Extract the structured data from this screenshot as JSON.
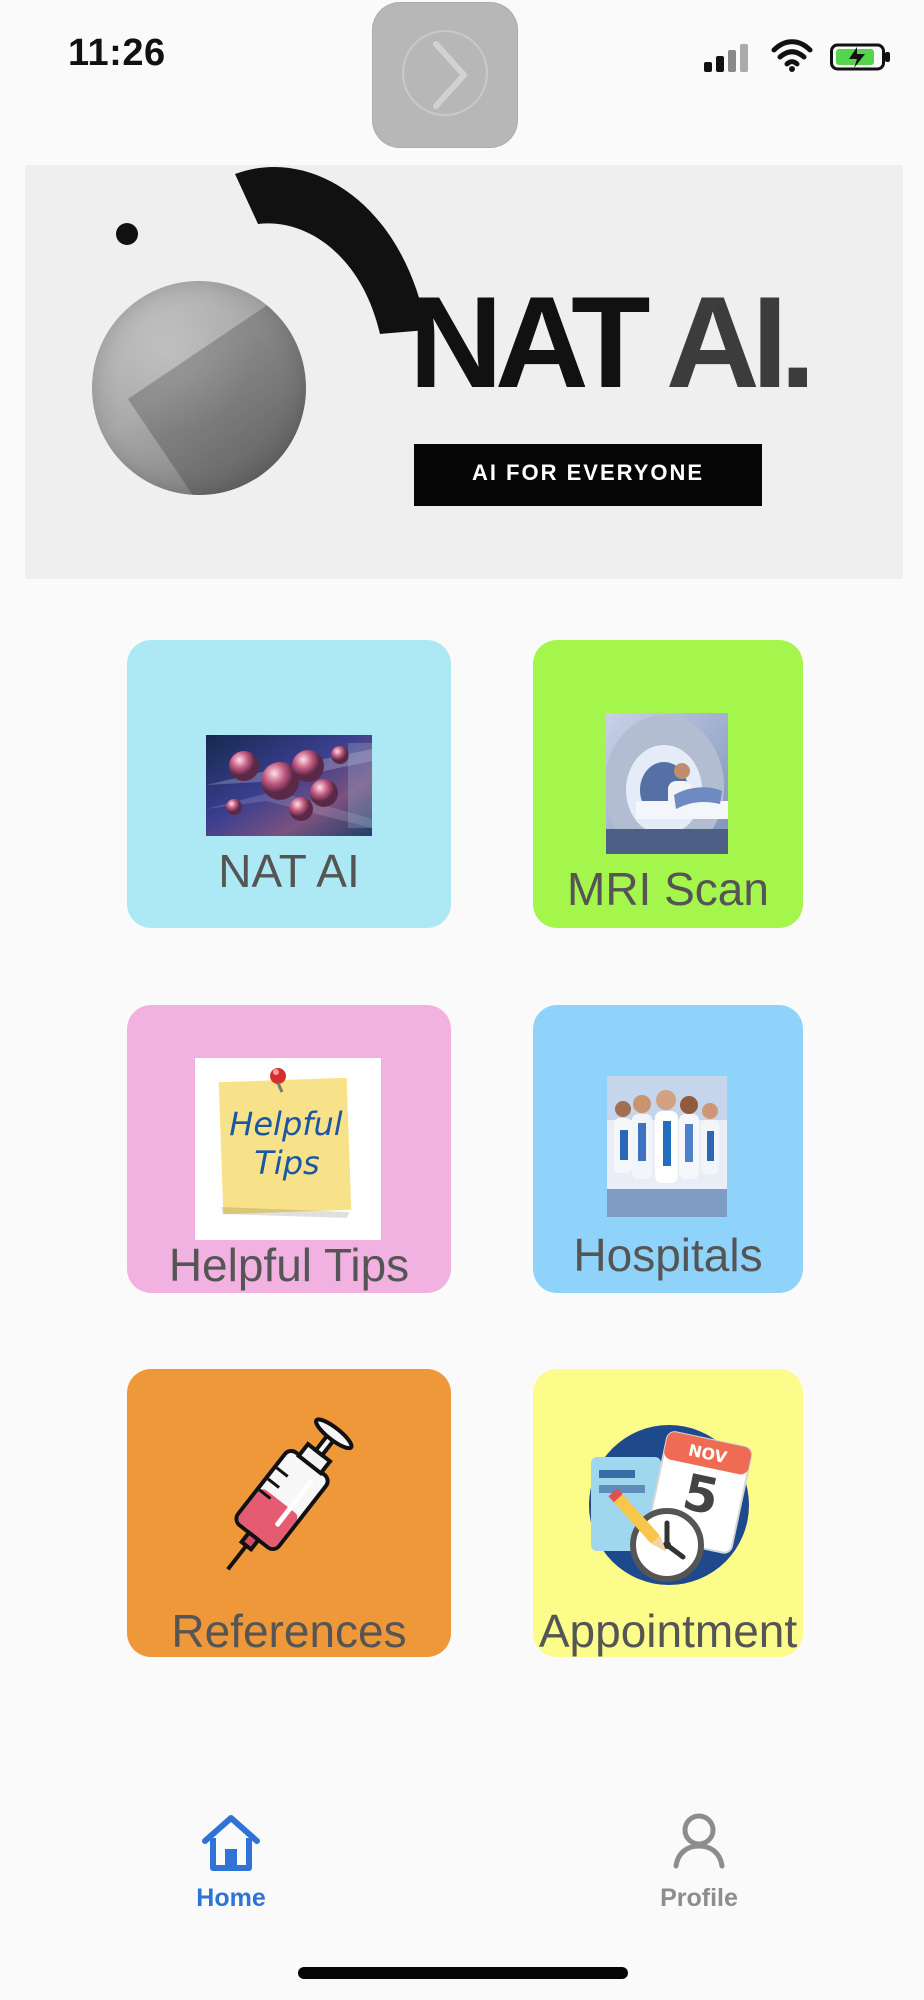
{
  "status_bar": {
    "time": "11:26"
  },
  "banner": {
    "title_primary": "NAT",
    "title_secondary": "AI.",
    "tagline": "AI FOR EVERYONE"
  },
  "tiles": [
    {
      "label": "NAT AI",
      "color": "#ade9f4",
      "image_icon": "cell-virus-image"
    },
    {
      "label": "MRI Scan",
      "color": "#a4f54c",
      "image_icon": "mri-scan-image"
    },
    {
      "label": "Helpful Tips",
      "color": "#f2b2e1",
      "image_icon": "helpful-tips-note-image",
      "image_text": "Helpful Tips"
    },
    {
      "label": "Hospitals",
      "color": "#8fd3fa",
      "image_icon": "medical-staff-image"
    },
    {
      "label": "References",
      "color": "#ef9839",
      "image_icon": "syringe-image"
    },
    {
      "label": "Appointment",
      "color": "#fcfc8a",
      "image_icon": "appointment-calendar-clock-image",
      "calendar_month": "NOV",
      "calendar_day": "5"
    }
  ],
  "bottom_nav": {
    "items": [
      {
        "label": "Home",
        "icon": "home-icon",
        "color": "#2f73d6"
      },
      {
        "label": "Profile",
        "icon": "profile-icon",
        "color": "#8d8d8d"
      }
    ]
  }
}
